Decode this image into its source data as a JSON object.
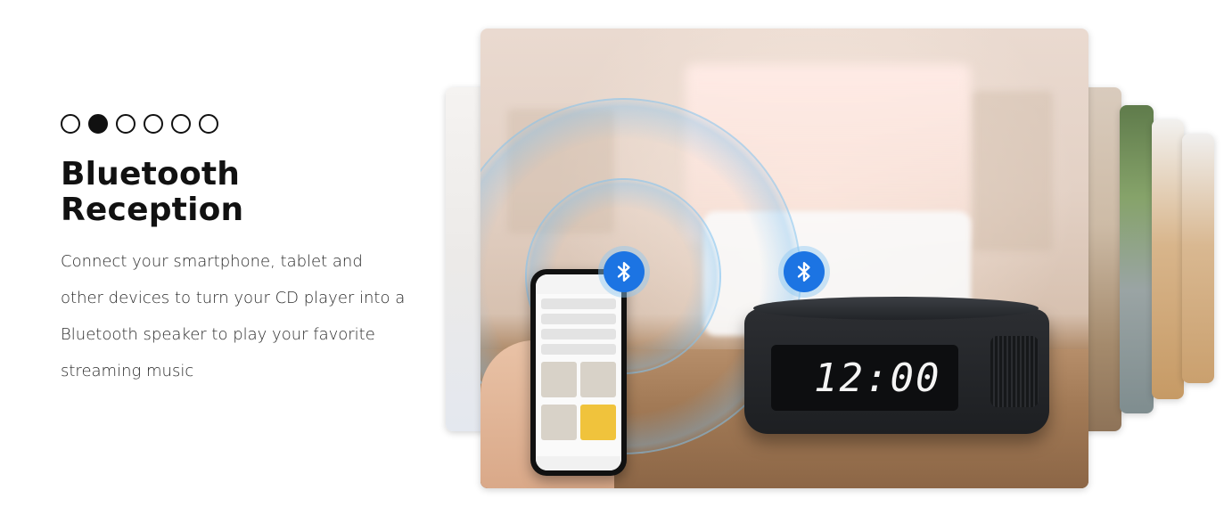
{
  "carousel": {
    "dot_count": 6,
    "active_index": 1
  },
  "slide": {
    "title": "Bluetooth Reception",
    "description": "Connect your smartphone, tablet and other devices to turn your CD player into a Bluetooth speaker to play your favorite streaming music"
  },
  "device": {
    "clock_time": "12:00"
  },
  "icons": {
    "bluetooth": "bluetooth-icon"
  },
  "colors": {
    "accent": "#1c74e3",
    "text": "#111111"
  }
}
